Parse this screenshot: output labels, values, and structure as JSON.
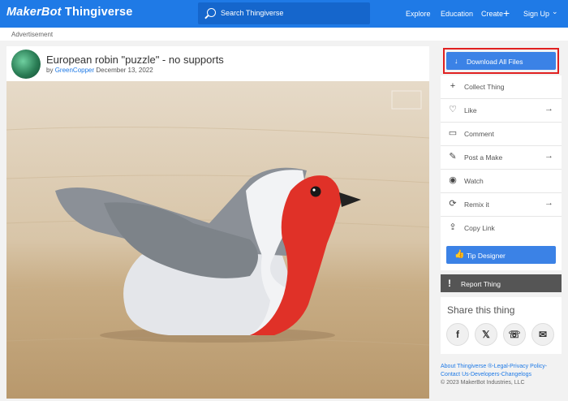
{
  "header": {
    "brand_part1": "MakerBot",
    "brand_part2": "Thingiverse",
    "search_placeholder": "Search Thingiverse",
    "nav": [
      "Explore",
      "Education",
      "Create",
      "Sign Up"
    ]
  },
  "ad_label": "Advertisement",
  "thing": {
    "title": "European robin \"puzzle\" - no supports",
    "by": "by",
    "author": "GreenCopper",
    "date": "December 13, 2022"
  },
  "sidebar": {
    "download_label": "Download All Files",
    "actions": [
      {
        "label": "Collect Thing",
        "icon": "plus-icon",
        "chevron": false
      },
      {
        "label": "Like",
        "icon": "heart-icon",
        "chevron": true
      },
      {
        "label": "Comment",
        "icon": "comment-icon",
        "chevron": false
      },
      {
        "label": "Post a Make",
        "icon": "make-icon",
        "chevron": true
      },
      {
        "label": "Watch",
        "icon": "eye-icon",
        "chevron": false
      },
      {
        "label": "Remix it",
        "icon": "remix-icon",
        "chevron": true
      },
      {
        "label": "Copy Link",
        "icon": "share-icon",
        "chevron": false
      }
    ],
    "tip_label": "Tip Designer",
    "report_label": "Report Thing",
    "share_title": "Share this thing",
    "share_buttons": [
      "facebook-icon",
      "twitter-icon",
      "whatsapp-icon",
      "email-icon"
    ]
  },
  "footer": {
    "line1": "About Thingiverse ®-Legal-Privacy Policy-",
    "line2": "Contact Us-Developers-Changelogs",
    "line3": "© 2023 MakerBot Industries, LLC"
  },
  "colors": {
    "primary": "#1f7ae6",
    "button": "#3b82e6",
    "highlight_border": "#e02020",
    "report_bg": "#555555"
  }
}
